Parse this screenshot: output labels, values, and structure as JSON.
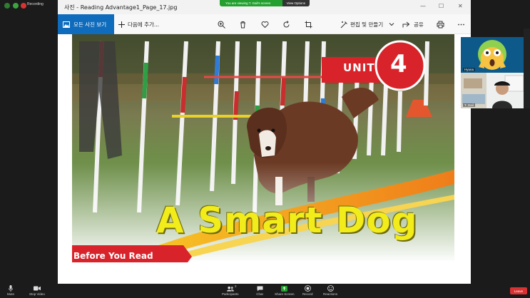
{
  "zoom": {
    "recording_label": "Recording",
    "banner_text": "You are viewing T. Gail's screen",
    "view_options_label": "View Options",
    "toolbar": [
      {
        "label": "Mute",
        "icon": "microphone-icon"
      },
      {
        "label": "Stop Video",
        "icon": "video-camera-icon"
      },
      {
        "label": "Participants",
        "icon": "participants-icon",
        "count": "2"
      },
      {
        "label": "Chat",
        "icon": "chat-icon"
      },
      {
        "label": "Share Screen",
        "icon": "share-screen-icon"
      },
      {
        "label": "Record",
        "icon": "record-icon"
      },
      {
        "label": "Reactions",
        "icon": "reactions-icon"
      }
    ],
    "leave_label": "Leave",
    "participants": [
      {
        "name": "Hyuna",
        "icon": "scream-emoji-icon"
      },
      {
        "name": "T. Gail"
      }
    ]
  },
  "photos": {
    "window_title": "사진 - Reading Advantage1_Page_17.jpg",
    "window_controls": [
      "—",
      "☐",
      "✕"
    ],
    "toolbar": {
      "all_photos_label": "모든 사진 보기",
      "add_to_label": "다음에 추가...",
      "edit_create_label": "편집 및 만들기",
      "share_label": "공유"
    },
    "image": {
      "unit_label": "UNIT",
      "unit_number": "4",
      "lesson_title": "A Smart Dog",
      "section_label": "Before You Read"
    }
  },
  "colors": {
    "accent_blue": "#0f6cbd",
    "banner_green": "#23a02f",
    "leave_red": "#d93232",
    "unit_red": "#d8232a",
    "title_yellow": "#f2ec1a"
  }
}
